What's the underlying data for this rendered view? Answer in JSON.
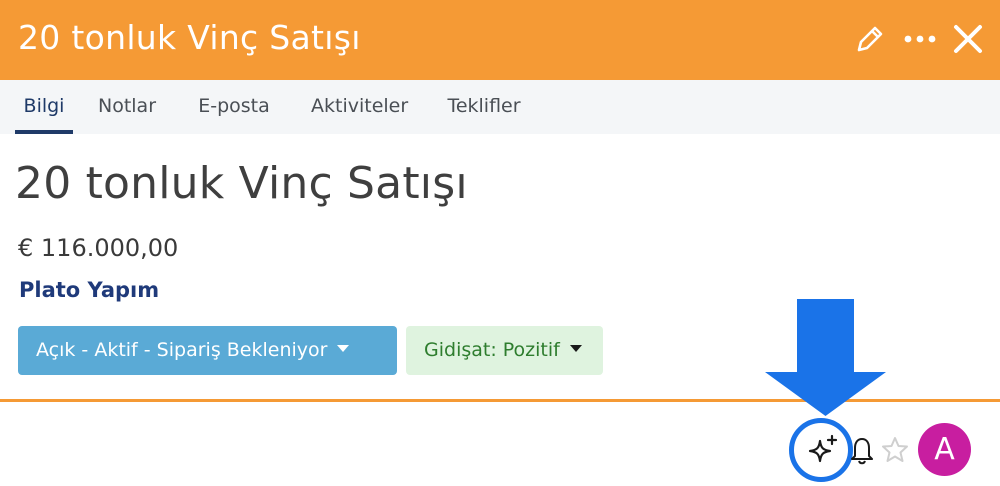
{
  "header": {
    "title": "20 tonluk Vinç Satışı",
    "icons": [
      "pencil-icon",
      "more-icon",
      "close-icon"
    ]
  },
  "tabs": [
    {
      "label": "Bilgi",
      "active": true
    },
    {
      "label": "Notlar",
      "active": false
    },
    {
      "label": "E-posta",
      "active": false
    },
    {
      "label": "Aktiviteler",
      "active": false
    },
    {
      "label": "Teklifler",
      "active": false
    }
  ],
  "deal": {
    "title": "20 tonluk Vinç Satışı",
    "amount": "€ 116.000,00",
    "company": "Plato Yapım"
  },
  "pills": {
    "status": "Açık - Aktif - Sipariş Bekleniyor",
    "trend": "Gidişat: Pozitif"
  },
  "toolbar": {
    "icons": [
      "ai-sparkle-icon",
      "bell-icon",
      "star-icon"
    ],
    "avatar_letter": "A"
  },
  "colors": {
    "header_bg": "#f59a35",
    "active_tab": "#1f3a68",
    "status_pill": "#5aaad6",
    "trend_pill": "#dff3df",
    "arrow": "#1a73e8",
    "avatar": "#c81ea0"
  }
}
